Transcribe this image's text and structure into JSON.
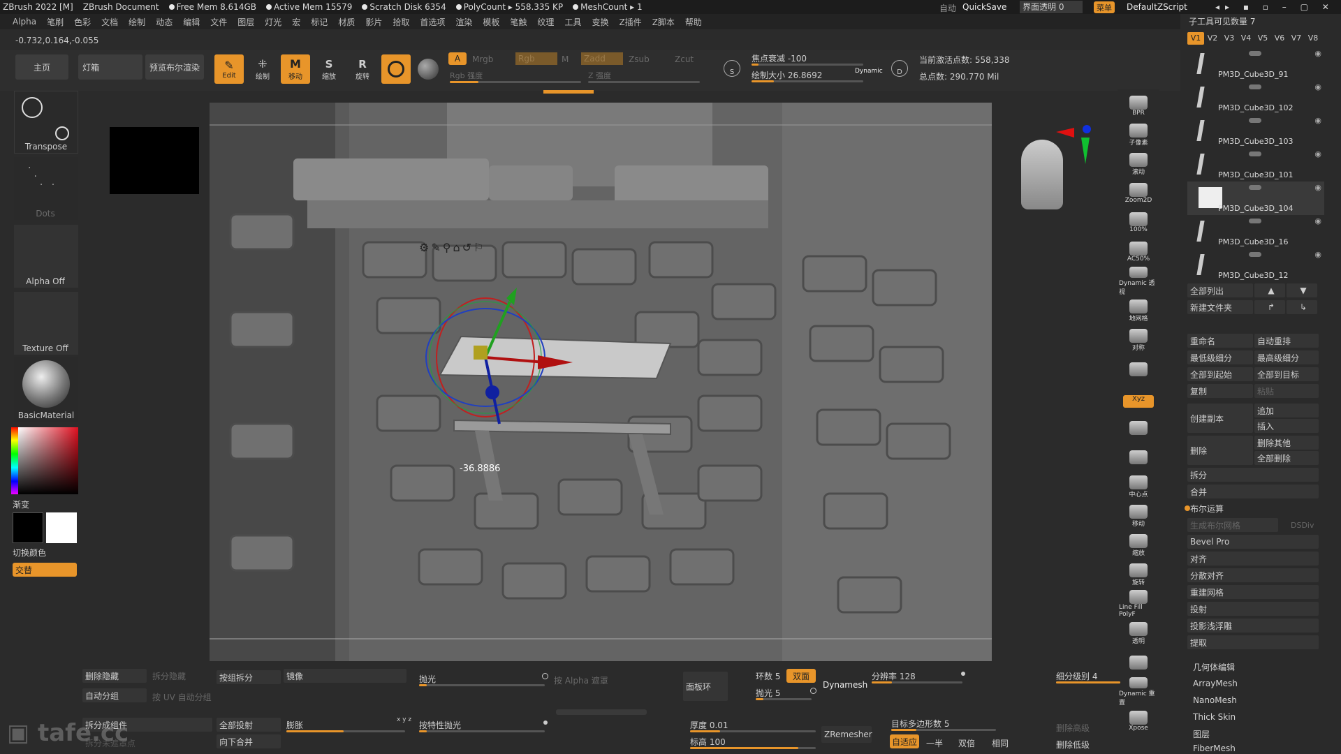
{
  "titlebar": {
    "app": "ZBrush 2022 [M]",
    "document": "ZBrush Document",
    "free_mem": "Free Mem 8.614GB",
    "active_mem": "Active Mem 15579",
    "scratch_disk": "Scratch Disk 6354",
    "polycount": "PolyCount ▸ 558.335 KP",
    "meshcount": "MeshCount ▸ 1",
    "auto": "自动",
    "quicksave": "QuickSave",
    "transparency": "界面透明 0",
    "menu": "菜单",
    "script": "DefaultZScript"
  },
  "menubar": [
    "Alpha",
    "笔刷",
    "色彩",
    "文档",
    "绘制",
    "动态",
    "编辑",
    "文件",
    "图层",
    "灯光",
    "宏",
    "标记",
    "材质",
    "影片",
    "拾取",
    "首选项",
    "渲染",
    "模板",
    "笔触",
    "纹理",
    "工具",
    "变换",
    "Z插件",
    "Z脚本",
    "帮助"
  ],
  "coords": "-0.732,0.164,-0.055",
  "top_tabs": {
    "home": "主页",
    "lightbox": "灯箱",
    "preview": "预览布尔渲染"
  },
  "top_tools": {
    "edit": "Edit",
    "draw": "绘制",
    "move": "移动",
    "scale": "缩放",
    "rotate": "旋转"
  },
  "channels": {
    "a": "A",
    "mrgb": "Mrgb",
    "rgb": "Rgb",
    "m": "M",
    "zadd": "Zadd",
    "zsub": "Zsub",
    "zcut": "Zcut",
    "rgb_intensity": "Rgb 强度",
    "z_intensity": "Z 强度"
  },
  "brush": {
    "focal": "焦点衰减 -100",
    "draw_size": "绘制大小 26.8692",
    "dynamic": "Dynamic",
    "s": "S",
    "d": "D"
  },
  "points": {
    "active": "当前激活点数: 558,338",
    "total": "总点数: 290.770 Mil"
  },
  "left": {
    "transpose": "Transpose",
    "dots": "Dots",
    "alpha": "Alpha Off",
    "texture": "Texture Off",
    "material": "BasicMaterial",
    "gradient": "渐变",
    "switch_color": "切换颜色",
    "alternate": "交替"
  },
  "viewport": {
    "value_readout": "-36.8886"
  },
  "right_icons": [
    "BPR",
    "子像素",
    "滚动",
    "Zoom2D",
    "100%",
    "AC50%",
    "Dynamic 透视",
    "地网格",
    "对称",
    "",
    "Xyz",
    "",
    "",
    "中心点",
    "移动",
    "缩放",
    "旋转",
    "Line Fill PolyF",
    "透明",
    "",
    "Dynamic 重置",
    "Xpose"
  ],
  "subtool": {
    "header": "子工具可见数量 7",
    "versions": [
      "V1",
      "V2",
      "V3",
      "V4",
      "V5",
      "V6",
      "V7",
      "V8"
    ],
    "items": [
      "PM3D_Cube3D_91",
      "PM3D_Cube3D_102",
      "PM3D_Cube3D_103",
      "PM3D_Cube3D_101",
      "PM3D_Cube3D_104",
      "PM3D_Cube3D_16",
      "PM3D_Cube3D_12"
    ],
    "list_all": "全部列出",
    "new_folder": "新建文件夹",
    "rename": "重命名",
    "auto_reorder": "自动重排",
    "lowest_sub": "最低级细分",
    "highest_sub": "最高级细分",
    "all_to_start": "全部到起始",
    "all_to_target": "全部到目标",
    "copy": "复制",
    "paste": "粘贴",
    "create_copy": "创建副本",
    "append": "追加",
    "insert": "插入",
    "delete": "删除",
    "delete_other": "删除其他",
    "delete_all": "全部删除",
    "split": "拆分",
    "merge": "合并",
    "boolean": "布尔运算",
    "gen_boolean": "生成布尔网格",
    "dsdiv": "DSDiv",
    "bevel": "Bevel Pro",
    "align": "对齐",
    "distribute": "分散对齐",
    "remesh": "重建网格",
    "project": "投射",
    "project_shallow": "投影浅浮雕",
    "extract": "提取",
    "geometry": "几何体编辑",
    "arraymesh": "ArrayMesh",
    "nanomesh": "NanoMesh",
    "thickskin": "Thick Skin",
    "layers": "图层",
    "fibermesh": "FiberMesh"
  },
  "bottom": {
    "del_hidden": "删除隐藏",
    "split_hidden": "拆分隐藏",
    "split_groups": "按组拆分",
    "mirror": "镜像",
    "polish": "抛光",
    "by_alpha": "按 Alpha 遮罩",
    "auto_group": "自动分组",
    "uv_group": "按 UV 自动分组",
    "split_parts": "拆分成组件",
    "all_project": "全部投射",
    "inflate": "膨胀",
    "xyz": "x y z",
    "feature_polish": "按特性抛光",
    "split_unmasked": "拆分未遮罩点",
    "merge_down": "向下合并",
    "panel_loops": "面板环",
    "loops": "环数 5",
    "double": "双面",
    "polish5": "抛光 5",
    "thickness": "厚度 0.01",
    "elevation": "标高 100",
    "dynamesh": "Dynamesh",
    "resolution": "分辨率 128",
    "sub_level": "细分级别 4",
    "zremesher": "ZRemesher",
    "target_poly": "目标多边形数 5",
    "adaptive": "自适应",
    "half": "一半",
    "double2": "双倍",
    "same": "相同",
    "del_higher": "删除高级",
    "del_lower": "删除低级"
  },
  "watermark": "tafe.cc",
  "colors": {
    "accent": "#e8952a",
    "panel": "#353535",
    "bg": "#2b2b2b",
    "viewport": "#575757"
  }
}
